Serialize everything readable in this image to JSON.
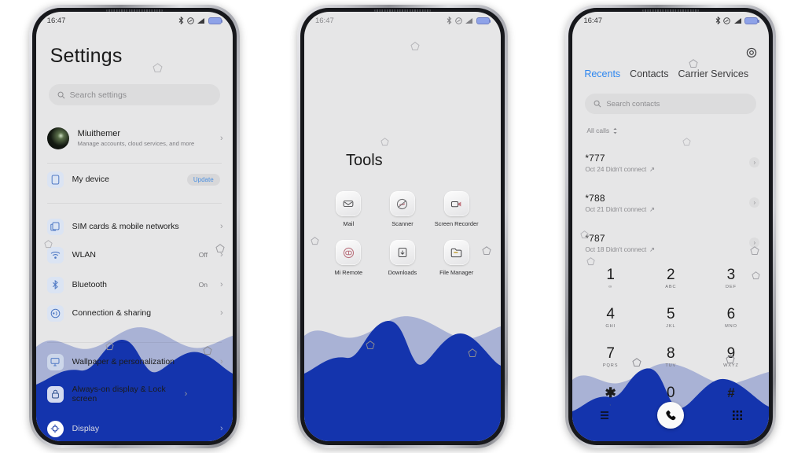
{
  "statusbar": {
    "time": "16:47",
    "icons": [
      "bluetooth-icon",
      "dnd-icon",
      "signal-icon",
      "battery-icon"
    ]
  },
  "settings_phone": {
    "title": "Settings",
    "search": {
      "placeholder": "Search settings",
      "icon": "search-icon"
    },
    "account": {
      "name": "Miuithemer",
      "subtitle": "Manage accounts, cloud services, and more",
      "chevron": "›"
    },
    "items": [
      {
        "label": "My device",
        "value": "",
        "badge": "Update",
        "icon": "phone-device-icon",
        "chevron": ""
      },
      {
        "label": "SIM cards & mobile networks",
        "value": "",
        "badge": "",
        "icon": "sim-card-icon",
        "chevron": "›"
      },
      {
        "label": "WLAN",
        "value": "Off",
        "badge": "",
        "icon": "wifi-icon",
        "chevron": "›"
      },
      {
        "label": "Bluetooth",
        "value": "On",
        "badge": "",
        "icon": "bluetooth-icon",
        "chevron": "›"
      },
      {
        "label": "Connection & sharing",
        "value": "",
        "badge": "",
        "icon": "connection-sharing-icon",
        "chevron": "›"
      },
      {
        "label": "Wallpaper & personalization",
        "value": "",
        "badge": "",
        "icon": "wallpaper-icon",
        "chevron": "›"
      },
      {
        "label": "Always-on display & Lock screen",
        "value": "",
        "badge": "",
        "icon": "lock-icon",
        "chevron": "›"
      },
      {
        "label": "Display",
        "value": "",
        "badge": "",
        "icon": "display-brightness-icon",
        "chevron": "›"
      }
    ]
  },
  "home_phone": {
    "folder_title": "Tools",
    "apps": [
      {
        "label": "Mail",
        "icon": "mail-icon"
      },
      {
        "label": "Scanner",
        "icon": "scanner-icon"
      },
      {
        "label": "Screen Recorder",
        "icon": "screen-recorder-icon"
      },
      {
        "label": "Mi Remote",
        "icon": "mi-remote-icon"
      },
      {
        "label": "Downloads",
        "icon": "downloads-icon"
      },
      {
        "label": "File Manager",
        "icon": "file-manager-icon"
      }
    ]
  },
  "dialer_phone": {
    "settings_icon": "gear-icon",
    "tabs": [
      {
        "label": "Recents",
        "active": true
      },
      {
        "label": "Contacts",
        "active": false
      },
      {
        "label": "Carrier Services",
        "active": false
      }
    ],
    "search": {
      "placeholder": "Search contacts",
      "icon": "search-icon"
    },
    "filter": {
      "label": "All calls",
      "icon": "sort-icon"
    },
    "calls": [
      {
        "number": "*777",
        "detail": "Oct 24 Didn't connect",
        "direction_icon": "outgoing-call-arrow-icon",
        "chevron": "›"
      },
      {
        "number": "*788",
        "detail": "Oct 21 Didn't connect",
        "direction_icon": "outgoing-call-arrow-icon",
        "chevron": "›"
      },
      {
        "number": "*787",
        "detail": "Oct 18 Didn't connect",
        "direction_icon": "outgoing-call-arrow-icon",
        "chevron": "›"
      }
    ],
    "keypad": [
      {
        "digit": "1",
        "letters": "∞"
      },
      {
        "digit": "2",
        "letters": "ABC"
      },
      {
        "digit": "3",
        "letters": "DEF"
      },
      {
        "digit": "4",
        "letters": "GHI"
      },
      {
        "digit": "5",
        "letters": "JKL"
      },
      {
        "digit": "6",
        "letters": "MNO"
      },
      {
        "digit": "7",
        "letters": "PQRS"
      },
      {
        "digit": "8",
        "letters": "TUV"
      },
      {
        "digit": "9",
        "letters": "WXYZ"
      },
      {
        "digit": "✱",
        "letters": ","
      },
      {
        "digit": "0",
        "letters": "+"
      },
      {
        "digit": "#",
        "letters": ""
      }
    ],
    "bottom_bar": [
      {
        "icon": "list-menu-icon"
      },
      {
        "icon": "call-button-icon"
      },
      {
        "icon": "keypad-icon"
      }
    ]
  },
  "theme": {
    "wave_light": "#a9b2d5",
    "wave_dark": "#1434ad",
    "accent_blue": "#2d86ef",
    "screen_bg": "#e6e6e7",
    "watermark": "pentagon-watermark"
  }
}
